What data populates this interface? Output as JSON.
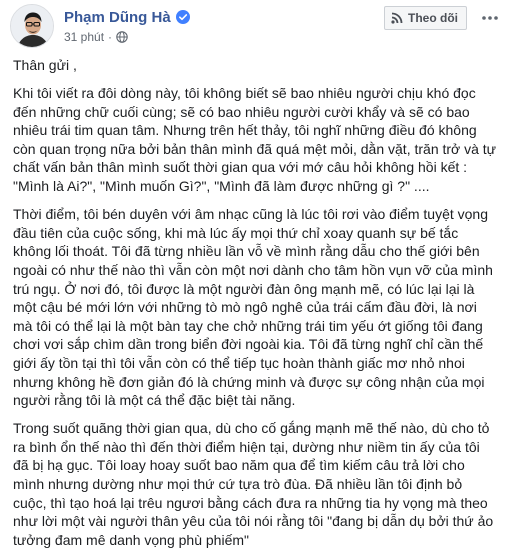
{
  "post": {
    "author": {
      "name": "Phạm Dũng Hà",
      "verified": true
    },
    "timestamp": "31 phút",
    "privacy_icon": "globe-icon",
    "follow_label": "Theo dõi",
    "more_icon": "more-options-icon",
    "paragraphs": [
      "Thân gửi ,",
      "Khi tôi viết ra đôi dòng này, tôi không biết sẽ bao nhiêu người chịu khó đọc đến những chữ cuối cùng; sẽ có bao nhiêu người cười khẩy và sẽ có bao nhiêu trái tim quan tâm. Nhưng trên hết thảy, tôi nghĩ những điều đó không còn quan trọng nữa bởi bản thân mình đã quá mệt mỏi, dằn vặt, trăn trở và tự chất vấn bản thân mình suốt thời gian qua với mớ câu hỏi không hồi kết : \"Mình là Ai?\", \"Mình muốn Gì?\", \"Mình đã làm được những gì ?\" ....",
      "Thời điểm, tôi bén duyên với âm nhạc cũng là lúc tôi rơi vào điểm tuyệt vọng đầu tiên của cuộc sống, khi mà lúc ấy mọi thứ chỉ xoay quanh sự bế tắc không lối thoát. Tôi đã từng nhiều lần vỗ về mình rằng dẫu cho thế giới bên ngoài có như thế nào thì vẫn còn một nơi dành cho tâm hồn vụn vỡ của mình trú ngụ. Ở nơi đó, tôi được là một người đàn ông mạnh mẽ, có lúc lại lại là một cậu bé mới lớn với những tò mò ngô nghê của trái cấm đầu đời, là nơi mà tôi có thể lại là một bàn tay che chở những trái tim yếu ớt giống tôi đang chơi vơi sắp chìm dần trong biển đời ngoài kia. Tôi đã từng nghĩ chỉ cần thế giới ấy tồn tại thì tôi vẫn còn có thể tiếp tục hoàn thành giấc mơ nhỏ nhoi nhưng không hề đơn giản đó là chứng minh và được sự công nhận của mọi người rằng tôi là một cá thể đặc biệt tài năng.",
      "Trong suốt quãng thời gian qua, dù cho cố gắng mạnh mẽ thế nào, dù cho tỏ ra bình ổn thế nào thì đến thời điểm hiện tại, dường như niềm tin ấy của tôi đã bị hạ gục. Tôi loay hoay suốt bao năm qua để tìm kiếm câu trả lời cho mình nhưng dường như mọi thứ cứ tựa trò đùa. Đã nhiều lần tôi định bỏ cuộc, thì tạo hoá lại trêu ngươi bằng cách đưa ra những tia hy vọng mà theo như lời một vài người thân yêu của tôi nói rằng tôi \"đang bị dẫn dụ bởi thứ ảo tưởng đam mê danh vọng phù phiếm\""
    ]
  },
  "colors": {
    "author_blue": "#385898",
    "verified_blue": "#4080ff",
    "meta_gray": "#606770",
    "text": "#1c1e21"
  }
}
